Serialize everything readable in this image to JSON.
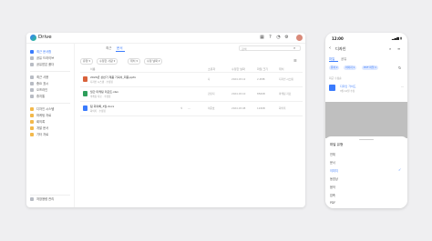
{
  "app": {
    "title": "Drive",
    "toolbar_icons": [
      "grid-icon",
      "help-icon",
      "bell-icon",
      "account-icon",
      "gear-icon",
      "apps-icon"
    ]
  },
  "sidebar": {
    "items": [
      {
        "label": "최근 문서함",
        "icon": "clock-icon"
      },
      {
        "label": "공유 드라이브",
        "icon": "shared-drive-icon"
      },
      {
        "label": "공유받은 폴더",
        "icon": "shared-folder-icon"
      },
      {
        "label": "최근 사용",
        "icon": "recent-icon"
      },
      {
        "label": "중요 표시",
        "icon": "star-icon"
      },
      {
        "label": "오프라인",
        "icon": "offline-icon"
      },
      {
        "label": "휴지통",
        "icon": "trash-icon"
      }
    ],
    "folders": [
      {
        "label": "디자인 시스템",
        "icon": "folder-icon"
      },
      {
        "label": "마케팅 자료",
        "icon": "folder-icon"
      },
      {
        "label": "회의록",
        "icon": "folder-icon"
      },
      {
        "label": "개발 문서",
        "icon": "folder-icon"
      },
      {
        "label": "기타 자료",
        "icon": "folder-icon"
      }
    ],
    "storage_label": "저장용량 관리"
  },
  "main": {
    "tabs": [
      "최근",
      "문서"
    ],
    "search_placeholder": "검색",
    "filters": [
      "유형",
      "수정한 사람",
      "위치",
      "수정 날짜"
    ],
    "columns": [
      "이름",
      "소유자",
      "수정한 날짜",
      "파일 크기",
      "위치"
    ],
    "rows": [
      {
        "name": "2024년 상반기 제품 기획서_최종.pptx",
        "sub": "디자인 시스템 · 수정됨",
        "owner": "나",
        "date": "2024.03.12",
        "size": "2.4MB",
        "location": "디자인 시스템",
        "color": "#d9623b"
      },
      {
        "name": "월간 마케팅 리포트.xlsx",
        "sub": "마케팅 자료 · 수정됨",
        "owner": "김민지",
        "date": "2024.03.10",
        "size": "856KB",
        "location": "마케팅 자료",
        "color": "#2e9e5b"
      },
      {
        "name": "팀 회의록_3월.docx",
        "sub": "회의록 · 수정됨",
        "owner": "이준호",
        "date": "2024.03.08",
        "size": "124KB",
        "location": "회의록",
        "color": "#3a7bfd"
      }
    ],
    "row_icons": [
      "share-icon",
      "more-icon"
    ]
  },
  "phone": {
    "time": "12:00",
    "status": "▂▄▆ ▮",
    "title": "디자인",
    "tabs": [
      "파일",
      "공유"
    ],
    "chips": [
      "문서",
      "이미지",
      "PDF 파일"
    ],
    "sort_label": "최근 수정순",
    "file_name": "디자인 가이드",
    "file_sub": "3월 12일 수정",
    "sheet_title": "파일 유형",
    "options": [
      "전체",
      "문서",
      "이미지",
      "동영상",
      "음악",
      "압축",
      "PDF",
      "기타"
    ],
    "selected_index": 2
  }
}
